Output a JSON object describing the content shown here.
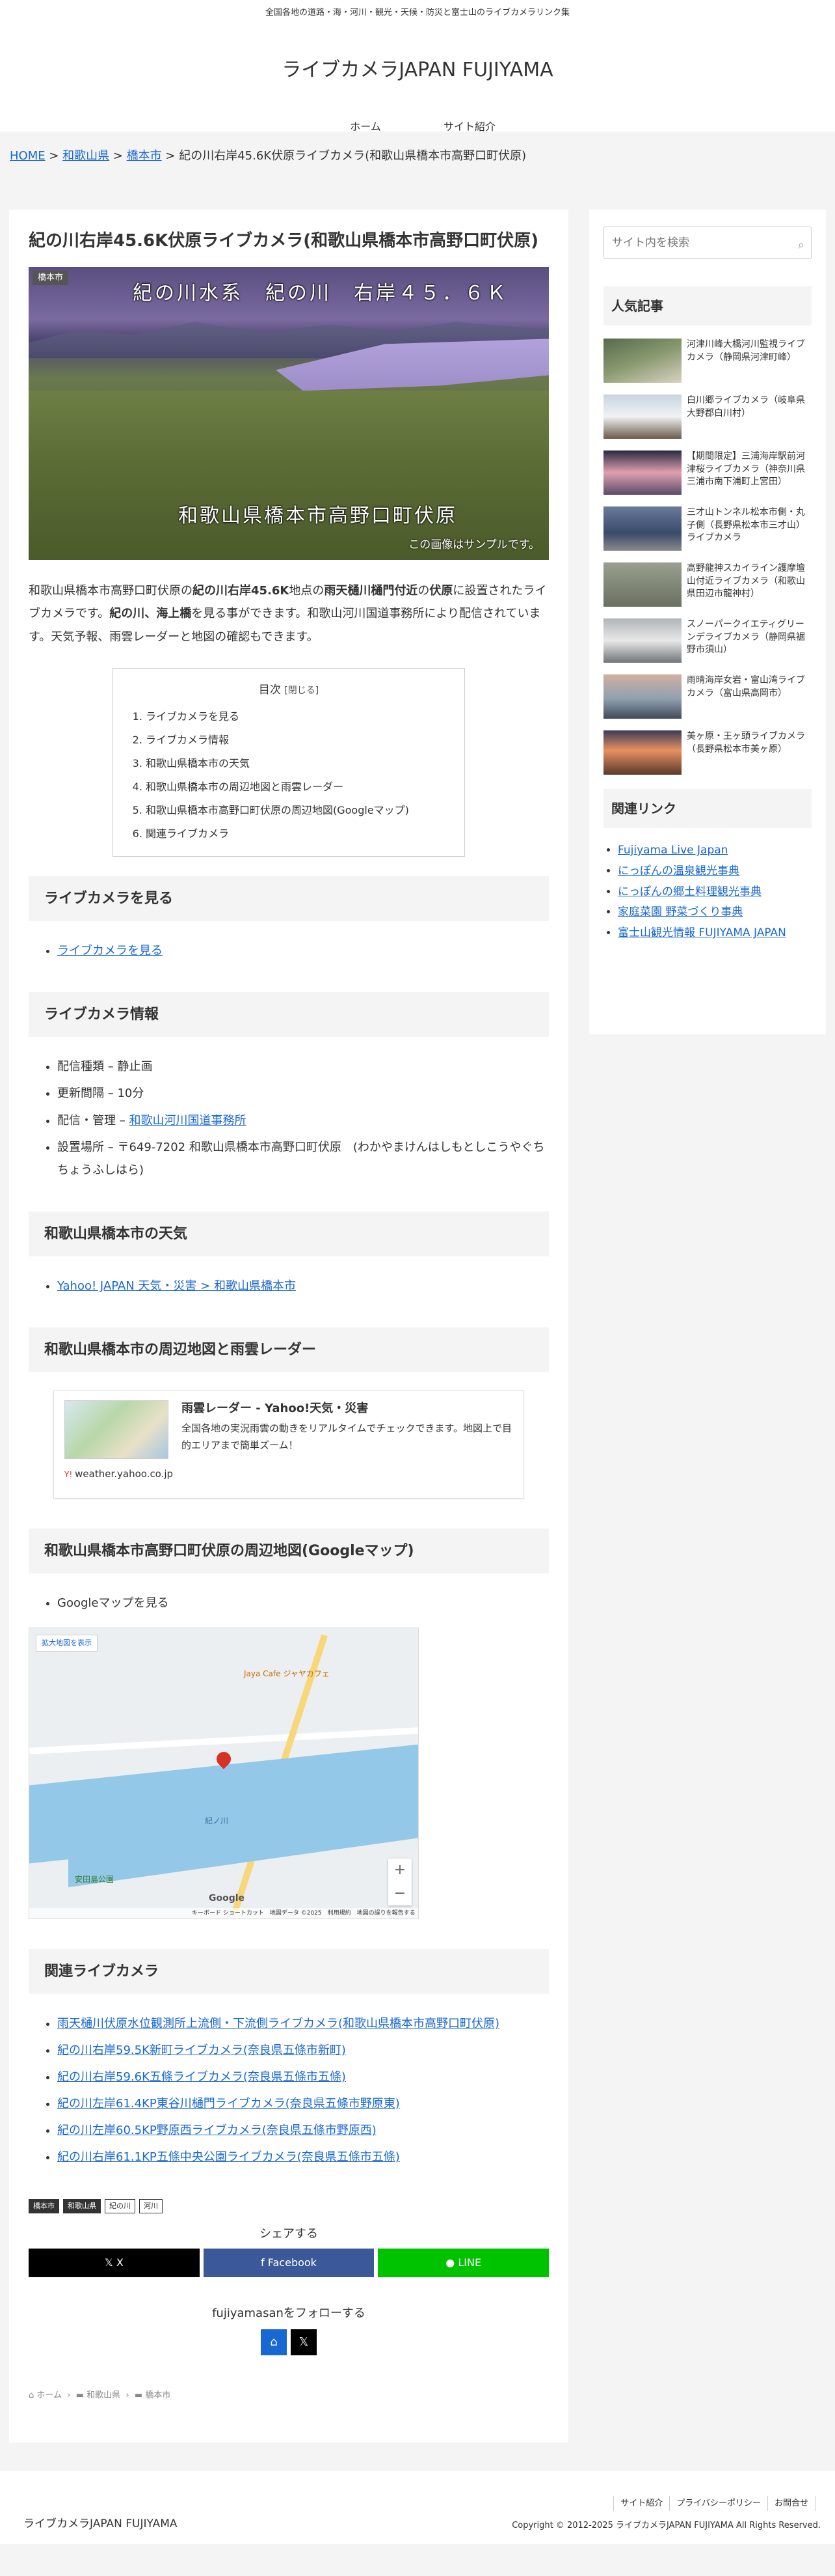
{
  "header": {
    "description": "全国各地の道路・海・河川・観光・天候・防災と富士山のライブカメラリンク集",
    "logo": "ライブカメラJAPAN FUJIYAMA",
    "nav": [
      "ホーム",
      "サイト紹介"
    ]
  },
  "breadcrumb": {
    "home": "HOME",
    "pref": "和歌山県",
    "city": "橋本市",
    "current": "紀の川右岸45.6K伏原ライブカメラ(和歌山県橋本市高野口町伏原)"
  },
  "article": {
    "title": "紀の川右岸45.6K伏原ライブカメラ(和歌山県橋本市高野口町伏原)",
    "eyecatch": {
      "tag": "橋本市",
      "cam_title": "紀の川水系　紀の川　右岸４５．６Ｋ",
      "cam_place": "和歌山県橋本市高野口町伏原",
      "sample": "この画像はサンプルです。"
    },
    "intro": {
      "p1": "和歌山県橋本市高野口町伏原の",
      "b1": "紀の川右岸45.6K",
      "p2": "地点の",
      "b2": "雨天樋川樋門付近",
      "p3": "の",
      "b3": "伏原",
      "p4": "に設置されたライブカメラです。",
      "b4": "紀の川、海上橋",
      "p5": "を見る事ができます。和歌山河川国道事務所により配信されています。天気予報、雨雲レーダーと地図の確認もできます。"
    },
    "toc": {
      "title": "目次",
      "toggle": "[閉じる]",
      "items": [
        "ライブカメラを見る",
        "ライブカメラ情報",
        "和歌山県橋本市の天気",
        "和歌山県橋本市の周辺地図と雨雲レーダー",
        "和歌山県橋本市高野口町伏原の周辺地図(Googleマップ)",
        "関連ライブカメラ"
      ]
    },
    "sections": {
      "watch": {
        "heading": "ライブカメラを見る",
        "link": "ライブカメラを見る"
      },
      "info": {
        "heading": "ライブカメラ情報",
        "type": "配信種類 – 静止画",
        "interval": "更新間隔 – 10分",
        "manager_prefix": "配信・管理 – ",
        "manager_link": "和歌山河川国道事務所",
        "location": "設置場所 – 〒649-7202 和歌山県橋本市高野口町伏原　(わかやまけんはしもとしこうやぐちちょうふしはら)"
      },
      "weather": {
        "heading": "和歌山県橋本市の天気",
        "link": "Yahoo! JAPAN 天気・災害 > 和歌山県橋本市"
      },
      "radar": {
        "heading": "和歌山県橋本市の周辺地図と雨雲レーダー",
        "card_title": "雨雲レーダー - Yahoo!天気・災害",
        "card_desc": "全国各地の実況雨雲の動きをリアルタイムでチェックできます。地図上で目的エリアまで簡単ズーム！",
        "card_site": "weather.yahoo.co.jp"
      },
      "gmap": {
        "heading": "和歌山県橋本市高野口町伏原の周辺地図(Googleマップ)",
        "item": "Googleマップを見る",
        "enlarge": "拡大地図を表示",
        "cafe": "Jaya Cafe ジャヤカフェ",
        "river": "紀ノ川",
        "park": "安田島公園",
        "google": "Google",
        "attribution": "キーボード ショートカット　地図データ ©2025　利用規約　地図の誤りを報告する"
      },
      "related": {
        "heading": "関連ライブカメラ",
        "items": [
          "雨天樋川伏原水位観測所上流側・下流側ライブカメラ(和歌山県橋本市高野口町伏原)",
          "紀の川右岸59.5K新町ライブカメラ(奈良県五條市新町)",
          "紀の川右岸59.6K五條ライブカメラ(奈良県五條市五條)",
          "紀の川左岸61.4KP東谷川樋門ライブカメラ(奈良県五條市野原東)",
          "紀の川左岸60.5KP野原西ライブカメラ(奈良県五條市野原西)",
          "紀の川右岸61.1KP五條中央公園ライブカメラ(奈良県五條市五條)"
        ]
      }
    },
    "tags": [
      "橋本市",
      "和歌山県",
      "紀の川",
      "河川"
    ],
    "share": {
      "title": "シェアする",
      "x": "X",
      "facebook": "Facebook",
      "line": "LINE"
    },
    "follow": {
      "title": "fujiyamasanをフォローする"
    },
    "bottom_crumb": {
      "home": "ホーム",
      "pref": "和歌山県",
      "city": "橋本市"
    }
  },
  "sidebar": {
    "search_placeholder": "サイト内を検索",
    "popular_title": "人気記事",
    "popular": [
      "河津川峰大橋河川監視ライブカメラ（静岡県河津町峰）",
      "白川郷ライブカメラ（岐阜県大野郡白川村）",
      "【期間限定】三浦海岸駅前河津桜ライブカメラ（神奈川県三浦市南下浦町上宮田）",
      "三才山トンネル松本市側・丸子側（長野県松本市三才山）ライブカメラ",
      "高野龍神スカイライン護摩壇山付近ライブカメラ（和歌山県田辺市龍神村）",
      "スノーパークイエティグリーンデライブカメラ（静岡県裾野市須山）",
      "雨晴海岸女岩・富山湾ライブカメラ（富山県高岡市）",
      "美ヶ原・王ヶ頭ライブカメラ（長野県松本市美ヶ原）"
    ],
    "related_title": "関連リンク",
    "related": [
      "Fujiyama Live Japan",
      "にっぽんの温泉観光事典",
      "にっぽんの郷土料理観光事典",
      "家庭菜園 野菜づくり事典",
      "富士山観光情報 FUJIYAMA JAPAN"
    ]
  },
  "footer": {
    "logo": "ライブカメラJAPAN FUJIYAMA",
    "nav": [
      "サイト紹介",
      "プライバシーポリシー",
      "お問合せ"
    ],
    "copyright": "Copyright © 2012-2025 ライブカメラJAPAN FUJIYAMA All Rights Reserved."
  }
}
